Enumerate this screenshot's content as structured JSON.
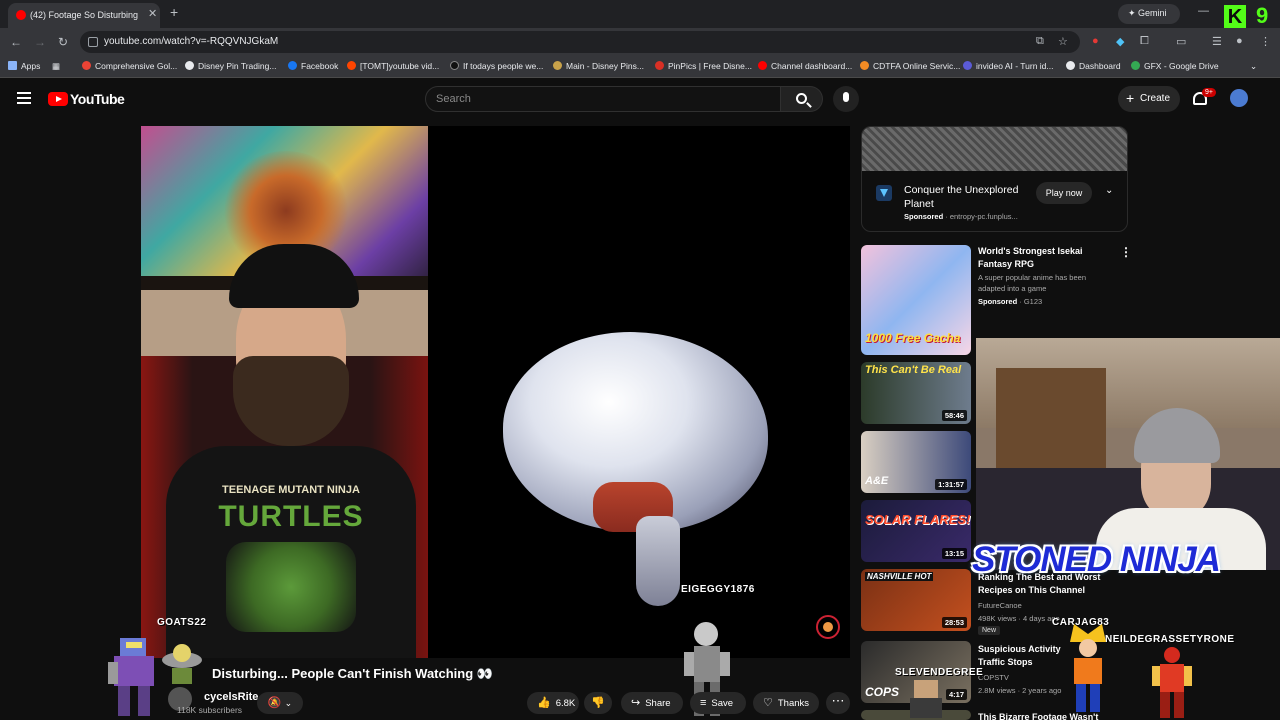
{
  "browser": {
    "tab_title": "(42) Footage So Disturbing",
    "url": "youtube.com/watch?v=-RQQVNJGkaM",
    "gemini_label": "Gemini",
    "kick_letter": "K",
    "kick_count": "9",
    "bookmarks": [
      {
        "label": "Apps",
        "color": "#8ab4f8"
      },
      {
        "label": "Comprehensive Gol...",
        "color": "#ea4335"
      },
      {
        "label": "Disney Pin Trading...",
        "color": "#e8eaed"
      },
      {
        "label": "Facebook",
        "color": "#1877f2"
      },
      {
        "label": "[TOMT]youtube vid...",
        "color": "#ff4500"
      },
      {
        "label": "If todays people we...",
        "color": "#111111"
      },
      {
        "label": "Main - Disney Pins...",
        "color": "#c8a24a"
      },
      {
        "label": "PinPics | Free Disne...",
        "color": "#d93025"
      },
      {
        "label": "Channel dashboard...",
        "color": "#ff0000"
      },
      {
        "label": "CDTFA Online Servic...",
        "color": "#f28b24"
      },
      {
        "label": "invideo AI - Turn id...",
        "color": "#5b5bd6"
      },
      {
        "label": "Dashboard",
        "color": "#e8eaed"
      },
      {
        "label": "GFX - Google Drive",
        "color": "#34a853"
      }
    ]
  },
  "youtube": {
    "logo_text": "YouTube",
    "search_placeholder": "Search",
    "create_label": "Create",
    "notif_count": "9+"
  },
  "video": {
    "title": "Disturbing... People Can't Finish Watching 👀",
    "channel": "cycelsRite",
    "subscribers": "118K subscribers",
    "likes": "6.8K",
    "share_label": "Share",
    "save_label": "Save",
    "thanks_label": "Thanks",
    "shirt_line1": "TEENAGE MUTANT NINJA",
    "shirt_line2": "TURTLES",
    "overlays": {
      "goat": "GOATS22",
      "eigeggy": "EIGEGGY1876"
    }
  },
  "sidebar": {
    "ad": {
      "title": "Conquer the Unexplored Planet",
      "sponsored": "Sponsored",
      "domain": "entropy-pc.funplus...",
      "cta": "Play now"
    },
    "items": [
      {
        "title": "World's Strongest Isekai Fantasy RPG",
        "meta1": "A super popular anime has been adapted into a game",
        "meta2_bold": "Sponsored",
        "meta2": "· G123",
        "thumb_text": "1000 Free Gacha",
        "duration": ""
      },
      {
        "title": "",
        "meta1": "",
        "meta2": "",
        "thumb_text": "This Can't Be Real",
        "duration": "58:46"
      },
      {
        "title": "",
        "meta1": "",
        "meta2": "",
        "thumb_text": "A&E",
        "duration": "1:31:57"
      },
      {
        "title": "",
        "meta1": "",
        "meta2": "",
        "thumb_text": "SOLAR FLARES!",
        "duration": "13:15"
      },
      {
        "title": "Ranking The Best and Worst Recipes on This Channel",
        "meta1": "FutureCanoe",
        "meta2": "498K views · 4 days ago",
        "badge": "New",
        "thumb_text": "NASHVILLE HOT",
        "duration": "28:53"
      },
      {
        "title": "Suspicious Activity Traffic Stops",
        "meta1": "COPSTV",
        "meta2": "2.8M views · 2 years ago",
        "thumb_text": "COPS",
        "duration": "4:17"
      },
      {
        "title": "This Bizarre Footage Wasn't",
        "meta1": "",
        "meta2": "",
        "thumb_text": "",
        "duration": ""
      }
    ]
  },
  "stream_overlay": {
    "banner": "STONED NINJA",
    "names": [
      "CARJAG83",
      "NEILDEGRASSETYRONE",
      "SLEVENDEGREE"
    ]
  }
}
